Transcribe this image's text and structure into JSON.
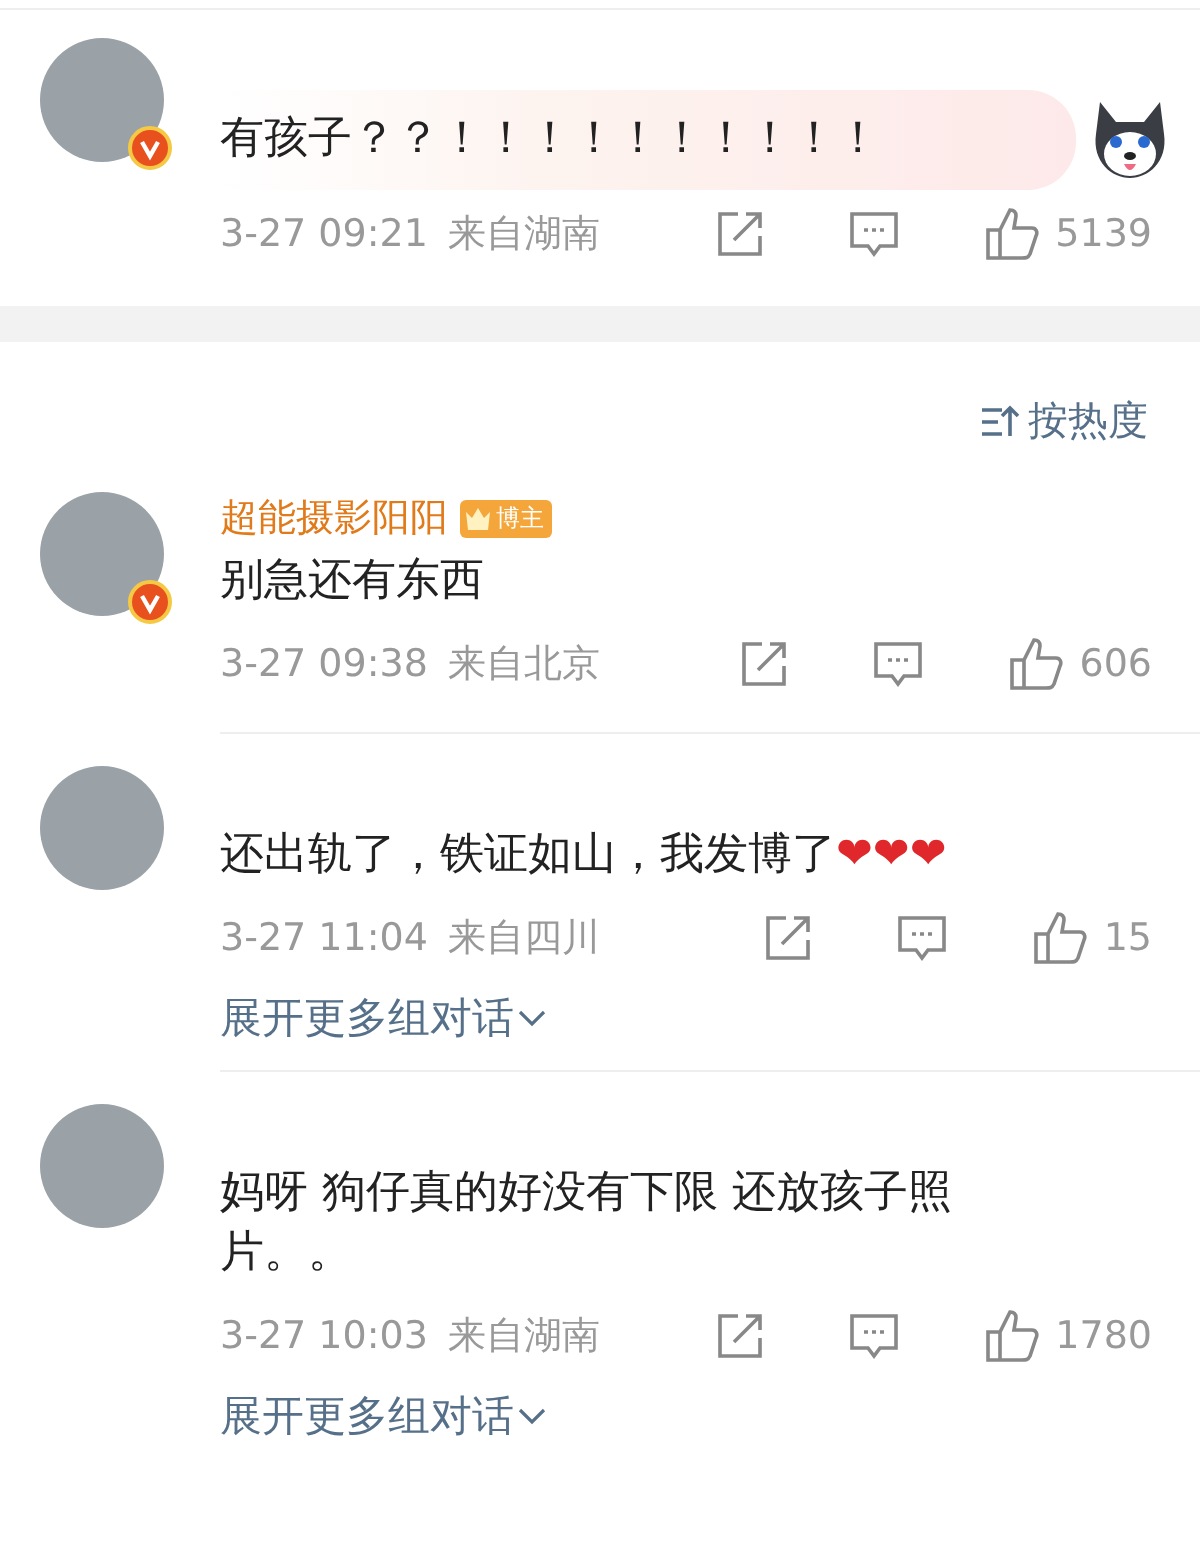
{
  "sort": {
    "label": "按热度"
  },
  "comments": [
    {
      "verified": true,
      "highlighted": true,
      "sticker": true,
      "text": "有孩子？？！！！！！！！！！！",
      "time": "3-27 09:21",
      "location": "来自湖南",
      "likes": "5139"
    },
    {
      "name": "超能摄影阳阳",
      "verified": true,
      "highlighted": false,
      "sticker": false,
      "badge": "博主",
      "text": "别急还有东西",
      "time": "3-27 09:38",
      "location": "来自北京",
      "likes": "606"
    },
    {
      "verified": false,
      "highlighted": false,
      "sticker": false,
      "text": "还出轨了，铁证如山，我发博了",
      "emoji": "❤❤❤",
      "time": "3-27 11:04",
      "location": "来自四川",
      "likes": "15",
      "expand": "展开更多组对话"
    },
    {
      "verified": false,
      "highlighted": false,
      "sticker": false,
      "text": "妈呀 狗仔真的好没有下限 还放孩子照片。。",
      "time": "3-27 10:03",
      "location": "来自湖南",
      "likes": "1780",
      "expand": "展开更多组对话"
    }
  ]
}
